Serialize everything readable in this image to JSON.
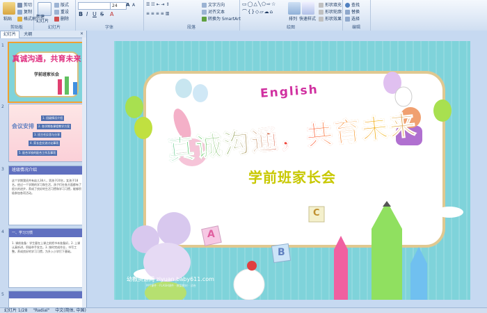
{
  "ribbon": {
    "clipboard": {
      "label": "剪贴板",
      "paste": "粘贴",
      "cut": "剪切",
      "copy": "复制",
      "format": "格式刷"
    },
    "slides": {
      "label": "幻灯片",
      "new": "新建\n幻灯片",
      "layout": "版式",
      "reset": "重设",
      "delete": "删除"
    },
    "font": {
      "label": "字体",
      "size": "24"
    },
    "paragraph": {
      "label": "段落",
      "direction": "文字方向",
      "align": "对齐文本",
      "smartart": "转换为 SmartArt"
    },
    "drawing": {
      "label": "绘图",
      "arrange": "排列",
      "quick_styles": "快速样式",
      "fill": "形状填充",
      "outline": "形状轮廓",
      "effects": "形状效果"
    },
    "editing": {
      "label": "编辑",
      "find": "查找",
      "replace": "替换",
      "select": "选择"
    }
  },
  "panel": {
    "tab_slides": "幻灯片",
    "tab_outline": "大纲",
    "thumbs": [
      {
        "num": "1",
        "title": "真诚沟通，共育未来",
        "subtitle": "学前班家长会"
      },
      {
        "num": "2",
        "title": "会议安排",
        "items": [
          "1. 班级情况介绍",
          "2. 各学期各课程教学方案",
          "3. 班主任反思与分享",
          "4. 家长会交流讨论事项",
          "5. 配合学校的配合工作及事项"
        ]
      },
      {
        "num": "3",
        "title": "班级情况介绍",
        "body": "这个学期我班共有幼儿38人，男孩子20名，女孩子18名。经过一个学期的学习和生活，孩子们在各方面都有了很大的进步，养成了良好的生活习惯和学习习惯，能够积极参加各项活动。"
      },
      {
        "num": "4",
        "title": "一、学习习惯",
        "body": "1. 课前准备：学生要在上课之前把书本准备好。2. 上课认真听讲，积极举手发言。3. 按时完成作业，书写工整。养成良好的学习习惯，为升入小学打下基础。"
      },
      {
        "num": "5"
      }
    ]
  },
  "slide": {
    "english_word": "English",
    "title": "真诚沟通，共育未来",
    "subtitle": "学前班家长会",
    "blocks": [
      "A",
      "B",
      "C"
    ],
    "watermark": "幼教资源网 ziyuan.baby611.com",
    "watermark_sub": "PPT课件 · FLASH课件 · 教案教材 · 试卷"
  },
  "status": {
    "slide": "幻灯片 1/28",
    "theme": "\"Radial\"",
    "lang": "中文(简体, 中国)"
  },
  "colors": {
    "title_gradient": [
      "#f0d000",
      "#ff3a3a",
      "#9040d0",
      "#20b0e0",
      "#40c040"
    ],
    "subtitle": "#c8c800",
    "slide_bg": "#7fd3da"
  }
}
